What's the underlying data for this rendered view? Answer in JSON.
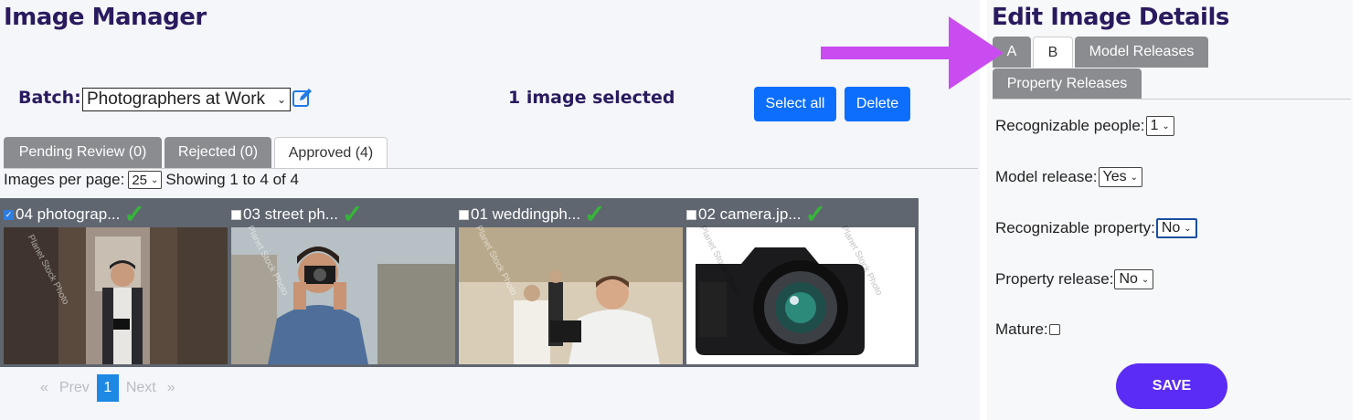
{
  "left": {
    "title": "Image Manager",
    "batch": {
      "label": "Batch:",
      "selected": "Photographers at Work"
    },
    "selection_status": "1 image selected",
    "buttons": {
      "select_all": "Select all",
      "delete": "Delete"
    },
    "tabs": [
      {
        "label": "Pending Review (0)"
      },
      {
        "label": "Rejected (0)"
      },
      {
        "label": "Approved (4)"
      }
    ],
    "per_page": {
      "label": "Images per page:",
      "value": "25",
      "showing": "Showing 1 to 4 of 4"
    },
    "images": [
      {
        "name": "04 photograp...",
        "checked": true
      },
      {
        "name": "03 street ph...",
        "checked": false
      },
      {
        "name": "01 weddingph...",
        "checked": false
      },
      {
        "name": "02 camera.jp...",
        "checked": false
      }
    ],
    "watermark": "Planet Stock Photo",
    "pager": {
      "first": "«",
      "prev": "Prev",
      "current": "1",
      "next": "Next",
      "last": "»"
    }
  },
  "right": {
    "title": "Edit Image Details",
    "tabs": [
      {
        "label": "A"
      },
      {
        "label": "B"
      },
      {
        "label": "Model Releases"
      },
      {
        "label": "Property Releases"
      }
    ],
    "fields": {
      "recognizable_people": {
        "label": "Recognizable people:",
        "value": "1"
      },
      "model_release": {
        "label": "Model release:",
        "value": "Yes"
      },
      "recognizable_property": {
        "label": "Recognizable property:",
        "value": "No"
      },
      "property_release": {
        "label": "Property release:",
        "value": "No"
      },
      "mature": {
        "label": "Mature:"
      }
    },
    "save": "SAVE"
  },
  "colors": {
    "heading": "#2a1a5e",
    "primary_button": "#0d6efd",
    "save_button": "#5b2cf5",
    "arrow": "#c94cf0",
    "approved_check": "#36b53a"
  }
}
